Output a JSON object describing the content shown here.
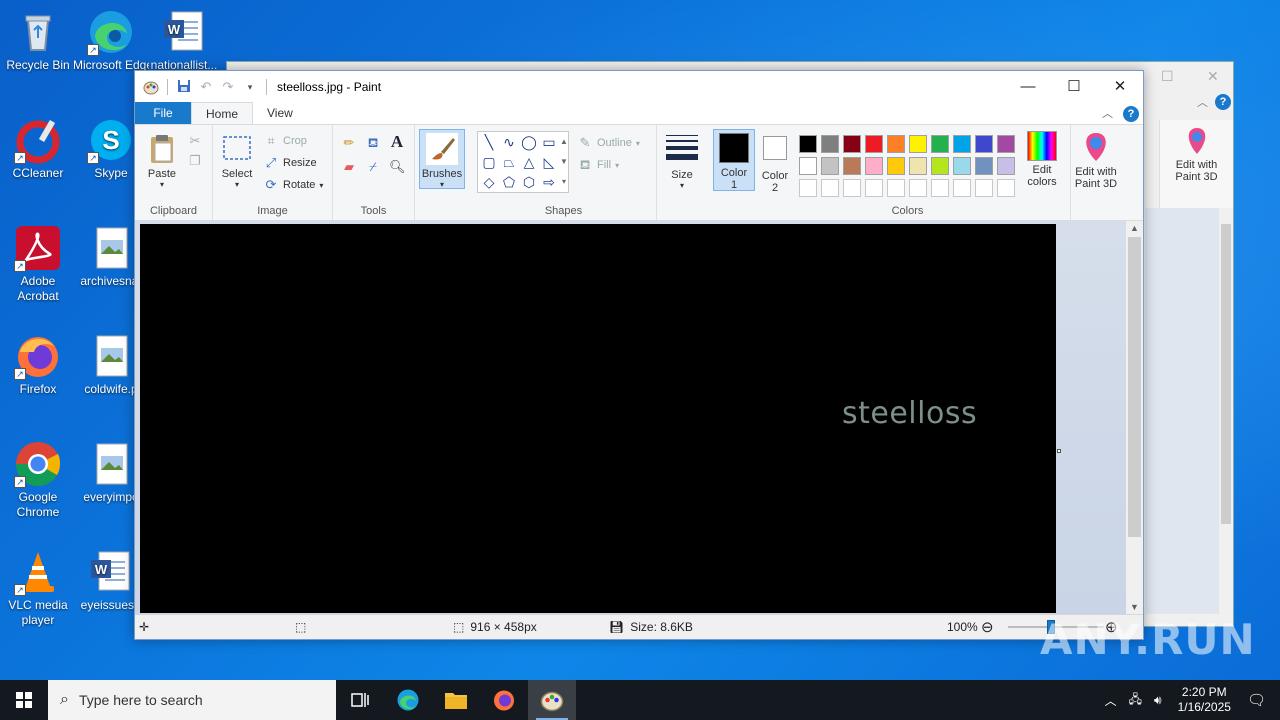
{
  "desktop": {
    "icons": [
      {
        "label": "Recycle Bin"
      },
      {
        "label": "Microsoft Edge"
      },
      {
        "label": "nationallist..."
      },
      {
        "label": "CCleaner"
      },
      {
        "label": "Skype"
      },
      {
        "label": "Adobe Acrobat"
      },
      {
        "label": "archivesnat"
      },
      {
        "label": "Firefox"
      },
      {
        "label": "coldwife.p"
      },
      {
        "label": "Google Chrome"
      },
      {
        "label": "everyimpo"
      },
      {
        "label": "VLC media player"
      },
      {
        "label": "eyeissues.r"
      }
    ]
  },
  "paint": {
    "title": "steelloss.jpg - Paint",
    "tabs": {
      "file": "File",
      "home": "Home",
      "view": "View"
    },
    "clipboard": {
      "paste": "Paste",
      "group": "Clipboard"
    },
    "image": {
      "select": "Select",
      "crop": "Crop",
      "resize": "Resize",
      "rotate": "Rotate",
      "group": "Image"
    },
    "tools": {
      "group": "Tools"
    },
    "brushes": {
      "label": "Brushes"
    },
    "shapes": {
      "outline": "Outline",
      "fill": "Fill",
      "group": "Shapes"
    },
    "size": {
      "label": "Size"
    },
    "color1": {
      "label1": "Color",
      "label2": "1"
    },
    "color2": {
      "label1": "Color",
      "label2": "2"
    },
    "colors": {
      "group": "Colors",
      "edit_colors_1": "Edit",
      "edit_colors_2": "colors",
      "palette_row1": [
        "#000000",
        "#7f7f7f",
        "#880015",
        "#ed1c24",
        "#ff7f27",
        "#fff200",
        "#22b14c",
        "#00a2e8",
        "#3f48cc",
        "#a349a4"
      ],
      "palette_row2": [
        "#ffffff",
        "#c3c3c3",
        "#b97a57",
        "#ffaec9",
        "#ffc90e",
        "#efe4b0",
        "#b5e61d",
        "#99d9ea",
        "#7092be",
        "#c8bfe7"
      ]
    },
    "paint3d": {
      "line1": "Edit with",
      "line2": "Paint 3D"
    },
    "canvas": {
      "text": "steelloss"
    },
    "status": {
      "dimensions": "916 × 458px",
      "size": "Size: 8.6KB",
      "zoom": "100%"
    }
  },
  "background_window": {
    "paint3d_line1": "Edit with",
    "paint3d_line2": "Paint 3D"
  },
  "watermark": "ANY.RUN",
  "taskbar": {
    "search_placeholder": "Type here to search",
    "time": "2:20 PM",
    "date": "1/16/2025"
  }
}
